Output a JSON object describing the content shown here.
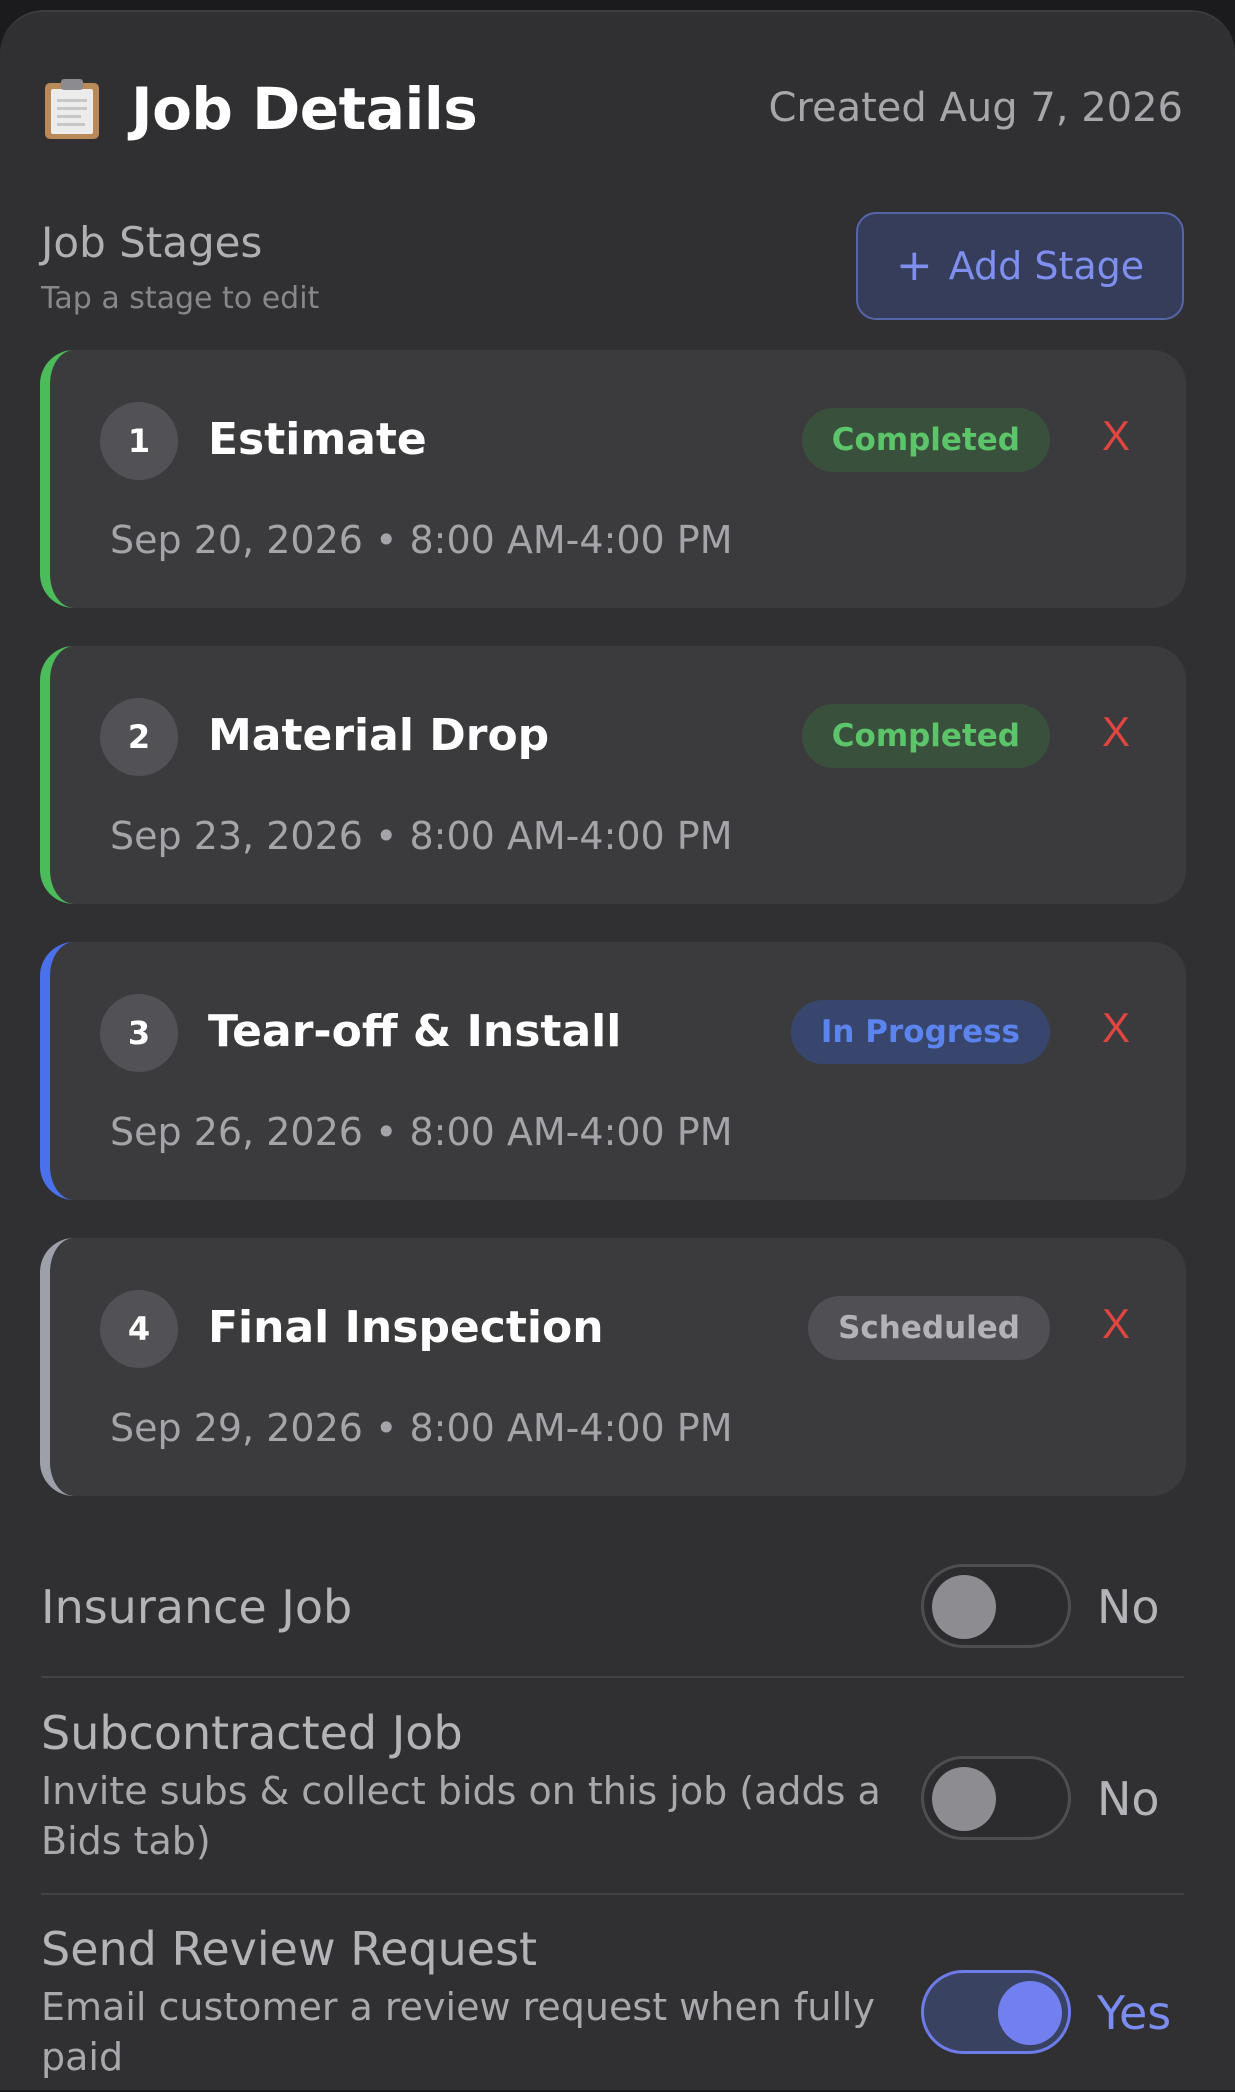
{
  "header": {
    "title": "Job Details",
    "created": "Created Aug 7, 2026",
    "icon": "clipboard-icon"
  },
  "stages_section": {
    "label": "Job Stages",
    "hint": "Tap a stage to edit",
    "add_button": "Add Stage",
    "add_icon": "+"
  },
  "stages": [
    {
      "number": "1",
      "name": "Estimate",
      "status": "Completed",
      "date": "Sep 20, 2026 • 8:00 AM-4:00 PM",
      "delete": "X",
      "accent": "#4cbb5a"
    },
    {
      "number": "2",
      "name": "Material Drop",
      "status": "Completed",
      "date": "Sep 23, 2026 • 8:00 AM-4:00 PM",
      "delete": "X",
      "accent": "#4cbb5a"
    },
    {
      "number": "3",
      "name": "Tear-off & Install",
      "status": "In Progress",
      "date": "Sep 26, 2026 • 8:00 AM-4:00 PM",
      "delete": "X",
      "accent": "#4b70ec"
    },
    {
      "number": "4",
      "name": "Final Inspection",
      "status": "Scheduled",
      "date": "Sep 29, 2026 • 8:00 AM-4:00 PM",
      "delete": "X",
      "accent": "#9d9fa9"
    }
  ],
  "settings": {
    "insurance": {
      "label": "Insurance Job",
      "value": "No",
      "on": false
    },
    "subcontracted": {
      "label": "Subcontracted Job",
      "description": "Invite subs & collect bids on this job (adds a Bids tab)",
      "value": "No",
      "on": false
    },
    "review": {
      "label": "Send Review Request",
      "description": "Email customer a review request when fully paid",
      "value": "Yes",
      "on": true
    }
  }
}
